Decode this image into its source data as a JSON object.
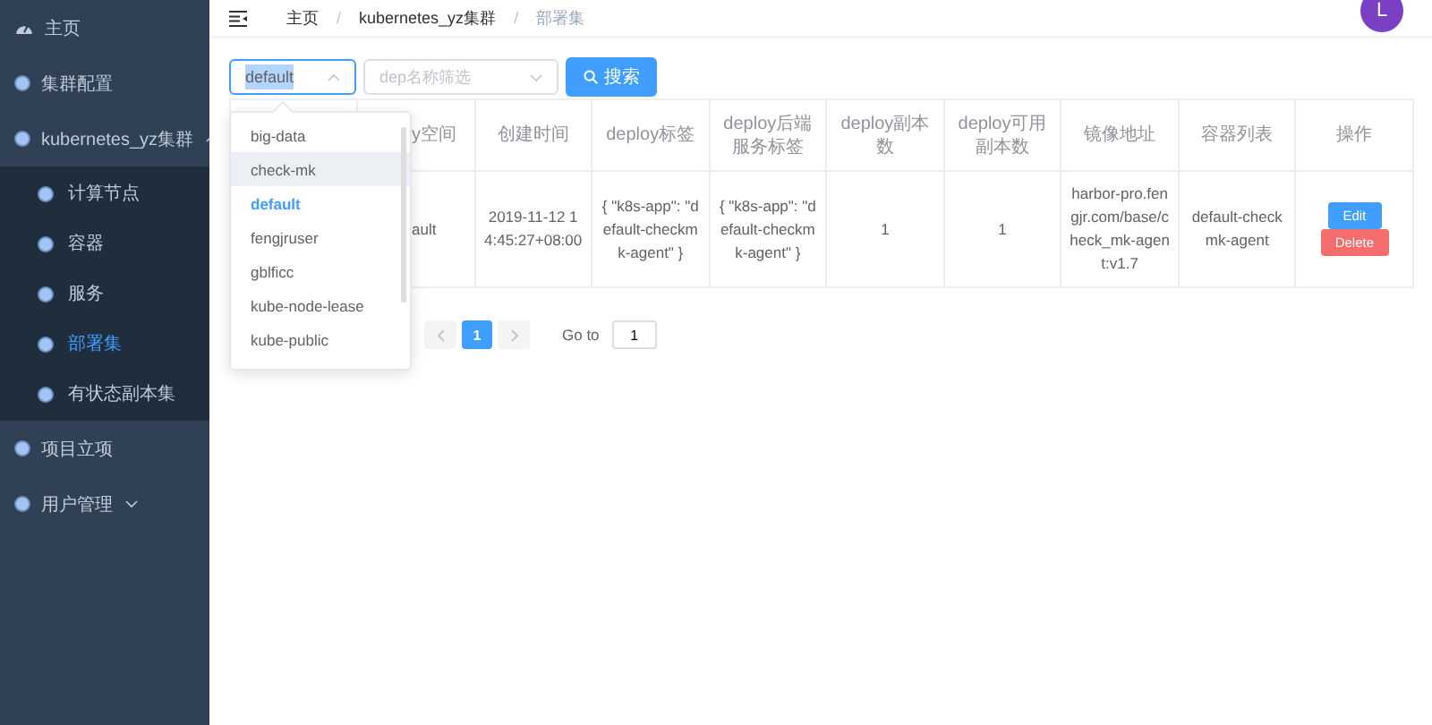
{
  "sidebar": {
    "items": [
      {
        "label": "主页",
        "kind": "dashboard",
        "selected": false
      },
      {
        "label": "集群配置",
        "kind": "group",
        "selected": false
      },
      {
        "label": "kubernetes_yz集群",
        "kind": "group",
        "selected": false,
        "expanded": true,
        "children": [
          {
            "label": "计算节点",
            "selected": false
          },
          {
            "label": "容器",
            "selected": false
          },
          {
            "label": "服务",
            "selected": false
          },
          {
            "label": "部署集",
            "selected": true
          },
          {
            "label": "有状态副本集",
            "selected": false
          }
        ]
      },
      {
        "label": "项目立项",
        "kind": "group",
        "selected": false
      },
      {
        "label": "用户管理",
        "kind": "group",
        "selected": false,
        "expanded": false
      }
    ]
  },
  "header": {
    "breadcrumb": [
      "主页",
      "kubernetes_yz集群",
      "部署集"
    ],
    "separators": [
      "/",
      "/"
    ],
    "avatar": "L"
  },
  "filters": {
    "namespace_select": {
      "value": "default",
      "expanded": true,
      "options": [
        {
          "label": "big-data",
          "selected": false,
          "hovered": false
        },
        {
          "label": "check-mk",
          "selected": false,
          "hovered": true
        },
        {
          "label": "default",
          "selected": true,
          "hovered": false
        },
        {
          "label": "fengjruser",
          "selected": false,
          "hovered": false
        },
        {
          "label": "gblficc",
          "selected": false,
          "hovered": false
        },
        {
          "label": "kube-node-lease",
          "selected": false,
          "hovered": false
        },
        {
          "label": "kube-public",
          "selected": false,
          "hovered": false
        }
      ]
    },
    "name_select": {
      "placeholder": "dep名称筛选"
    },
    "search_button": "搜索"
  },
  "table": {
    "columns": [
      "y空间",
      "创建时间",
      "deploy标签",
      "deploy后端服务标签",
      "deploy副本数",
      "deploy可用副本数",
      "镜像地址",
      "容器列表",
      "操作"
    ],
    "rows": [
      {
        "cells": [
          "ault",
          "2019-11-12 14:45:27+08:00",
          "{ \"k8s-app\": \"default-checkmk-agent\" }",
          "{ \"k8s-app\": \"default-checkmk-agent\" }",
          "1",
          "1",
          "harbor-pro.fengjr.com/base/check_mk-agent:v1.7",
          "default-checkmk-agent"
        ],
        "actions": [
          {
            "label": "Edit",
            "kind": "primary"
          },
          {
            "label": "Delete",
            "kind": "danger"
          }
        ]
      }
    ]
  },
  "pagination": {
    "pages": [
      {
        "label": "1",
        "selected": true
      }
    ],
    "goto_label": "Go to",
    "goto_value": "1"
  }
}
